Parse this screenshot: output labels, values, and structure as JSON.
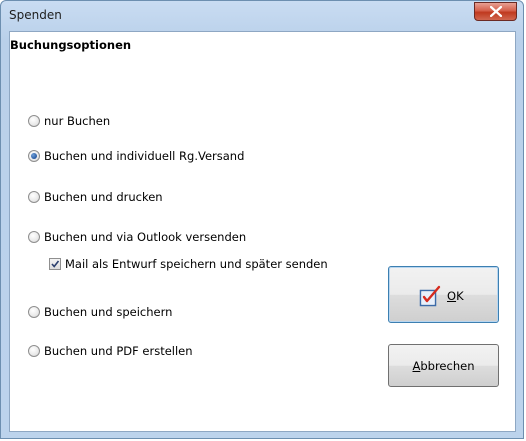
{
  "window": {
    "title": "Spenden"
  },
  "group": {
    "title": "Buchungsoptionen"
  },
  "options": [
    {
      "label": "nur Buchen",
      "checked": false
    },
    {
      "label": "Buchen und individuell Rg.Versand",
      "checked": true
    },
    {
      "label": "Buchen und drucken",
      "checked": false
    },
    {
      "label": "Buchen und via Outlook versenden",
      "checked": false
    },
    {
      "label": "Buchen und speichern",
      "checked": false
    },
    {
      "label": "Buchen und PDF erstellen",
      "checked": false
    }
  ],
  "draft_checkbox": {
    "label": "Mail als Entwurf speichern und später senden",
    "checked": true
  },
  "buttons": {
    "ok_label": "OK",
    "ok_icon": "checkbox-document-icon",
    "cancel_label": "Abbrechen"
  },
  "colors": {
    "title_bar": "#bcd3ec",
    "close_button": "#c0391f",
    "radio_selected": "#1d4f99"
  }
}
